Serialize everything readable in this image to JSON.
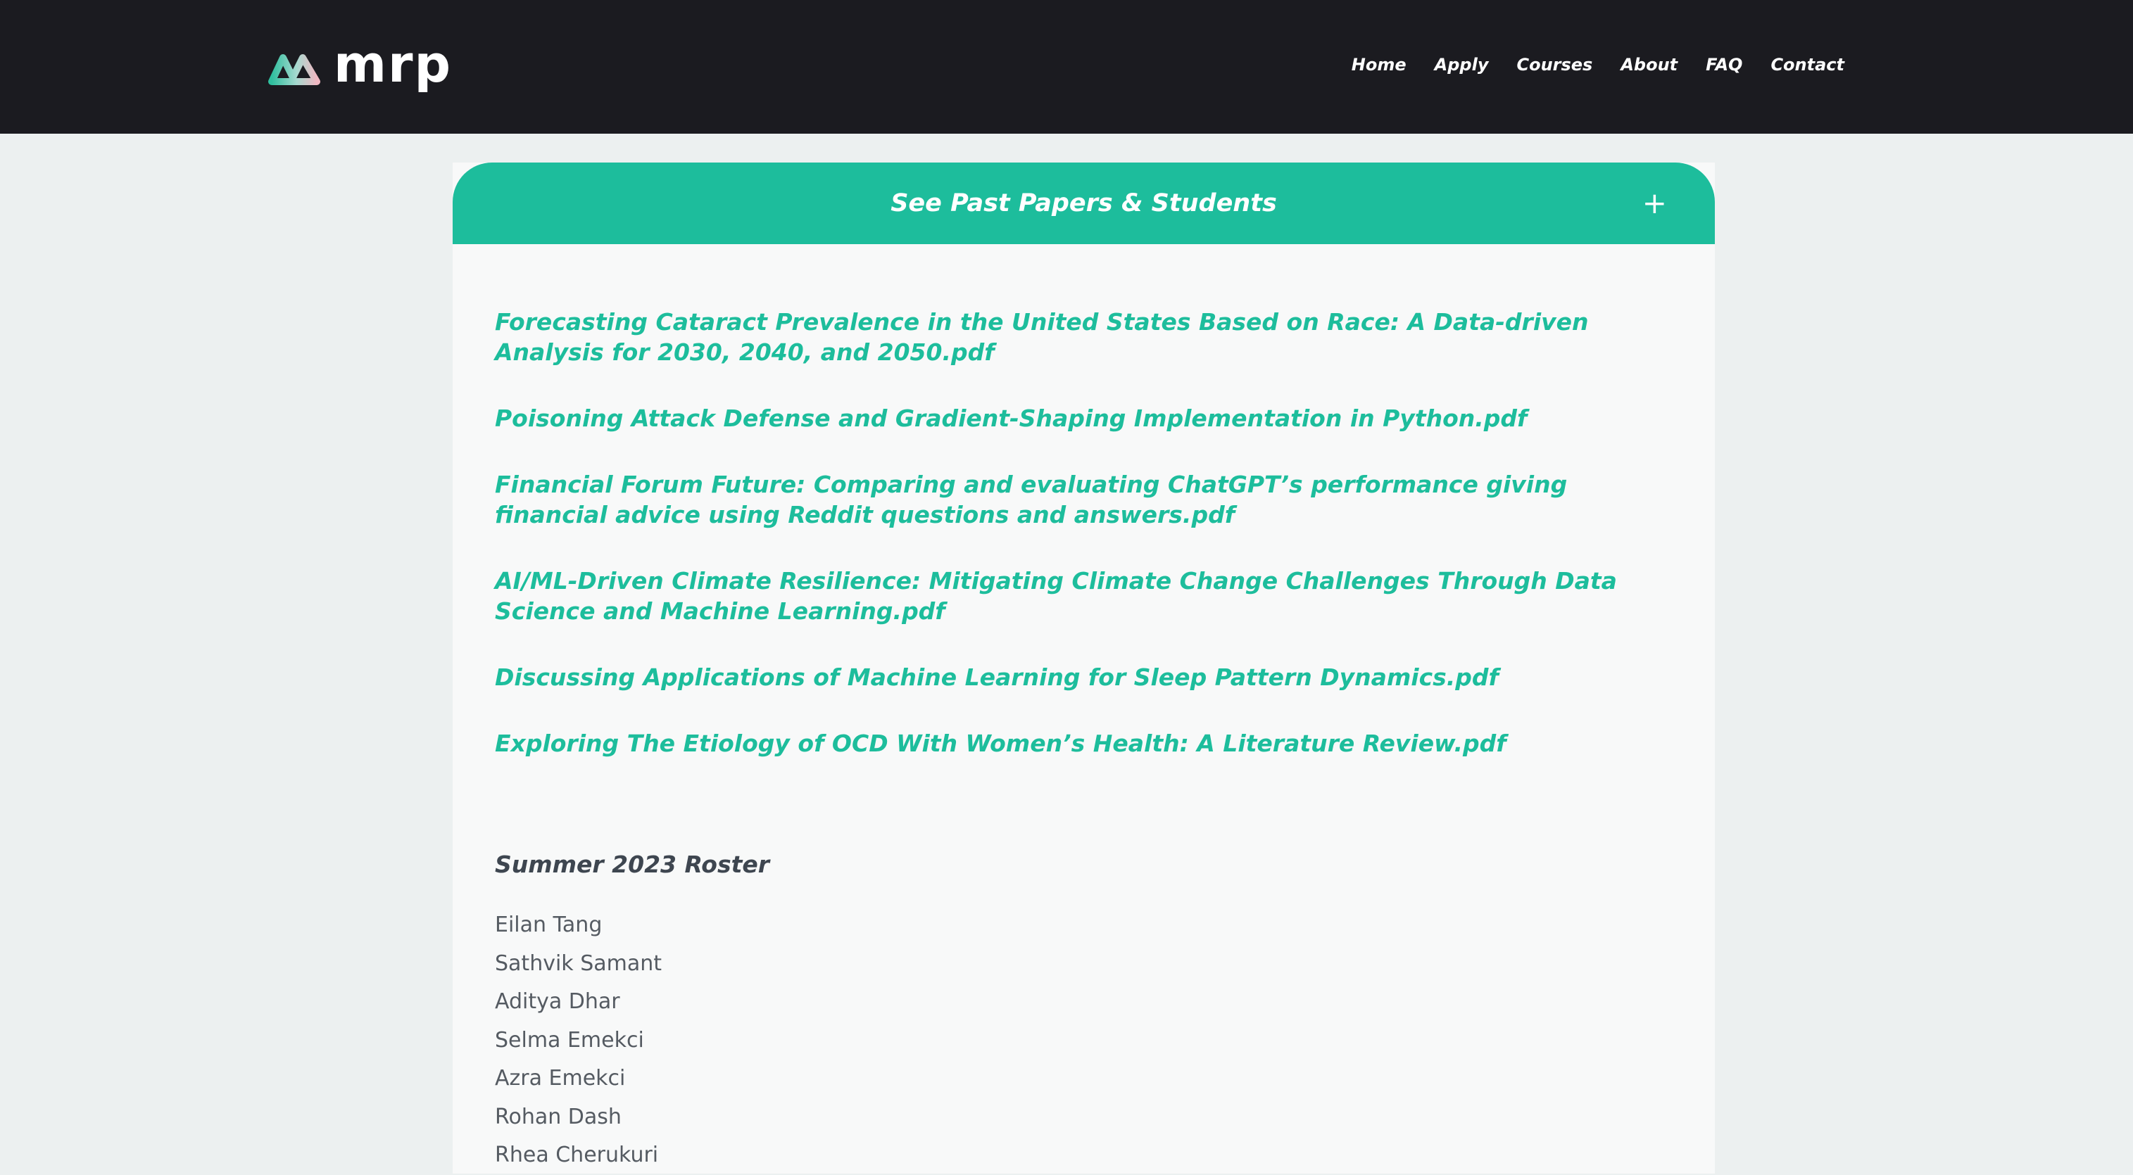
{
  "header": {
    "logo_text": "mrp",
    "nav": [
      "Home",
      "Apply",
      "Courses",
      "About",
      "FAQ",
      "Contact"
    ]
  },
  "accordion": {
    "title": "See Past Papers & Students",
    "toggle": "+"
  },
  "papers": [
    "Forecasting Cataract Prevalence in the United States Based on Race: A Data-driven Analysis for 2030, 2040, and 2050.pdf",
    "Poisoning Attack Defense and Gradient-Shaping Implementation in Python.pdf",
    "Financial Forum Future: Comparing and evaluating ChatGPT’s performance giving financial advice using Reddit questions and answers.pdf",
    "AI/ML-Driven Climate Resilience: Mitigating Climate Change Challenges Through Data Science and Machine Learning.pdf",
    "Discussing Applications of Machine Learning for Sleep Pattern Dynamics.pdf",
    "Exploring The Etiology of OCD With Women’s Health: A Literature Review.pdf"
  ],
  "roster": {
    "title": "Summer 2023 Roster",
    "students": [
      "Eilan Tang",
      "Sathvik Samant",
      "Aditya Dhar",
      "Selma Emekci",
      "Azra Emekci",
      "Rohan Dash",
      "Rhea Cherukuri"
    ]
  },
  "colors": {
    "header_bg": "#1b1b20",
    "accent": "#1dbd9c",
    "page_bg": "#ecf0f0",
    "panel_bg": "#f8f9f9"
  },
  "icons": {
    "logo": "mrp-logo-mark",
    "toggle": "plus-icon"
  }
}
